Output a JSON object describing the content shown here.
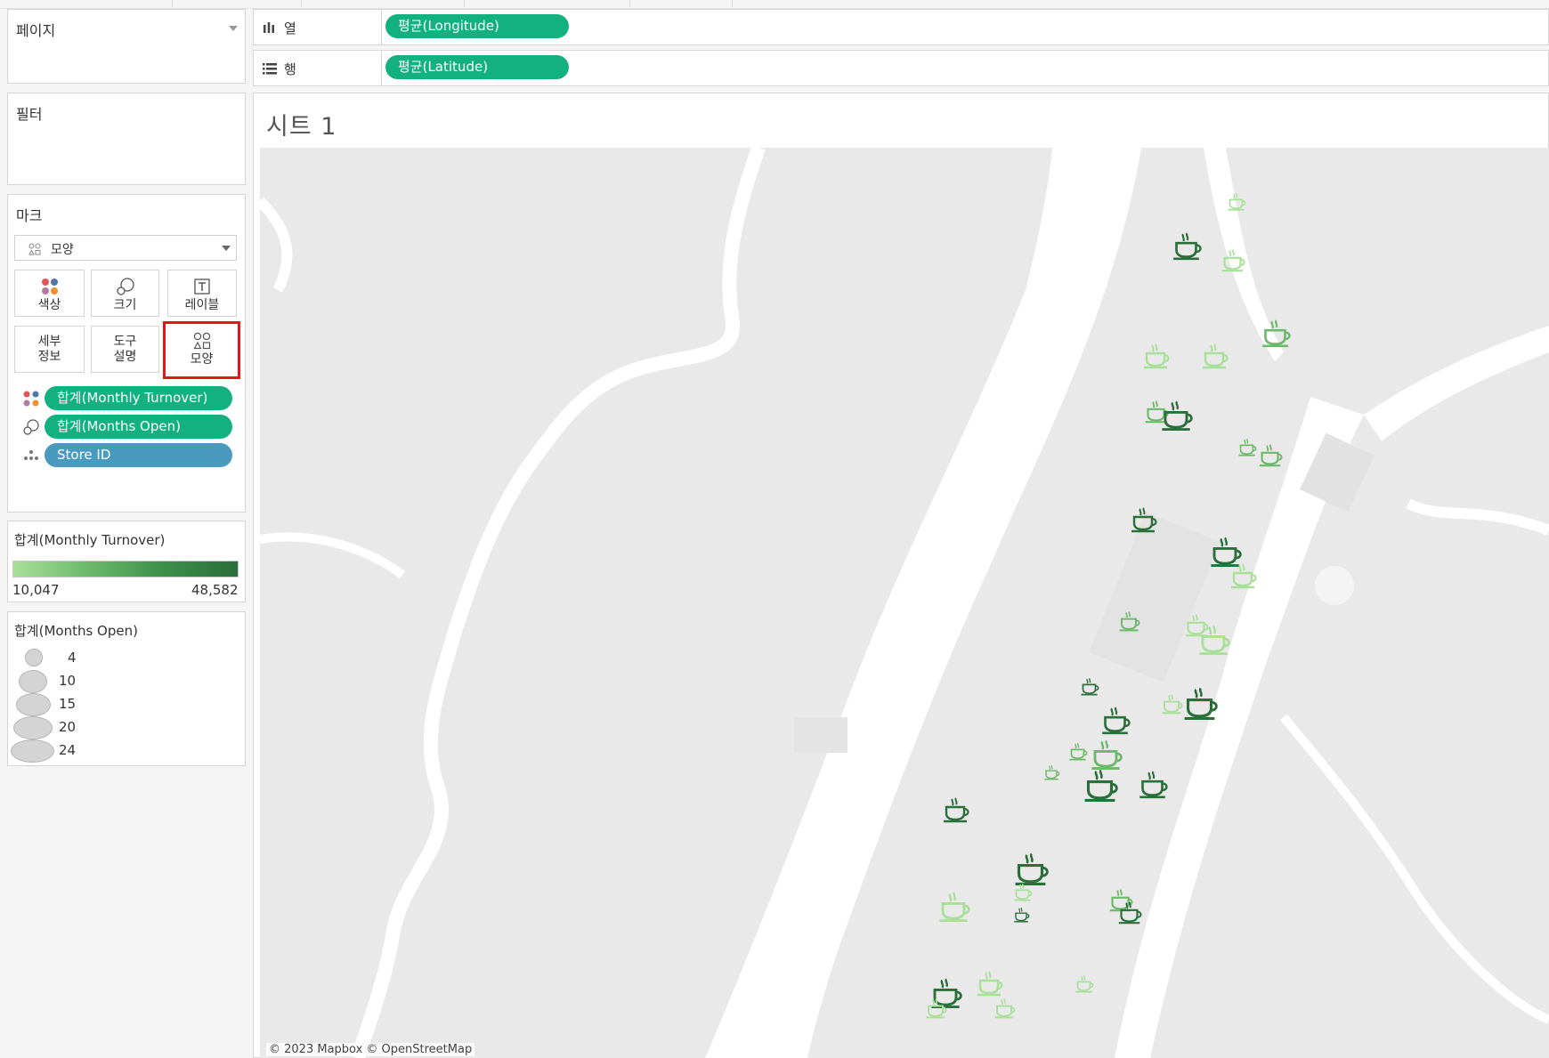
{
  "cards": {
    "pages": {
      "title": "페이지"
    },
    "filters": {
      "title": "필터"
    },
    "marks": {
      "title": "마크",
      "mark_type": "모양",
      "buttons": [
        {
          "label": "색상",
          "icon": "color-icon"
        },
        {
          "label": "크기",
          "icon": "size-icon"
        },
        {
          "label": "레이블",
          "icon": "label-icon"
        },
        {
          "label": "세부\n정보",
          "icon": "detail-icon"
        },
        {
          "label": "도구\n설명",
          "icon": "tooltip-icon"
        },
        {
          "label": "모양",
          "icon": "shape-icon",
          "highlighted": true
        }
      ],
      "fields": [
        {
          "encoding": "color",
          "label": "합계(Monthly Turnover)",
          "kind": "measure"
        },
        {
          "encoding": "size",
          "label": "합계(Months Open)",
          "kind": "measure"
        },
        {
          "encoding": "detail",
          "label": "Store ID",
          "kind": "dimension"
        }
      ]
    },
    "color_legend": {
      "title": "합계(Monthly Turnover)",
      "min": "10,047",
      "max": "48,582",
      "gradient_colors": [
        "#a9e099",
        "#2a6f3a"
      ]
    },
    "size_legend": {
      "title": "합계(Months Open)",
      "items": [
        "4",
        "10",
        "15",
        "20",
        "24"
      ]
    }
  },
  "shelves": {
    "columns": {
      "label": "열",
      "pill": "평균(Longitude)"
    },
    "rows": {
      "label": "행",
      "pill": "평균(Latitude)"
    }
  },
  "sheet": {
    "title": "시트 1"
  },
  "map": {
    "attribution": "© 2023 Mapbox © OpenStreetMap",
    "mark_shape": "coffee-cup-icon",
    "colors": {
      "low": "#a9e099",
      "mid": "#6cb96a",
      "high": "#2a6f3a",
      "pill_measure": "#13b080",
      "pill_dimension": "#4a9abf",
      "highlight": "#e8141b"
    }
  }
}
